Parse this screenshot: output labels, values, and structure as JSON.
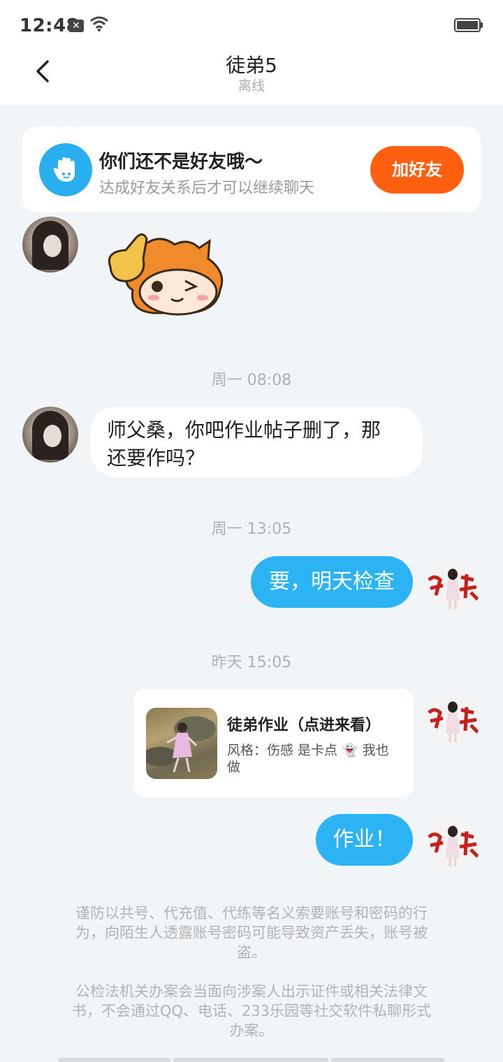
{
  "status_bar": {
    "time": "12:48",
    "notification_icon": "close-box-icon",
    "wifi_icon": "wifi-icon",
    "battery_icon": "battery-icon"
  },
  "header": {
    "title": "徒弟5",
    "subtitle": "离线",
    "back_icon": "chevron-left-icon"
  },
  "friend_banner": {
    "icon": "hand-wave-icon",
    "title": "你们还不是好友哦～",
    "subtitle": "达成好友关系后才可以继续聊天",
    "button_label": "加好友",
    "button_color": "#ff5f0e"
  },
  "messages": [
    {
      "type": "sticker",
      "sender": "other",
      "sticker_name": "wink-sticker"
    },
    {
      "type": "timestamp",
      "text": "周一 08:08"
    },
    {
      "type": "text",
      "sender": "other",
      "text_line1": "师父桑，你吧作业帖子删了，那",
      "text_line2": "还要作吗？"
    },
    {
      "type": "timestamp",
      "text": "周一 13:05"
    },
    {
      "type": "text",
      "sender": "me",
      "text": "要，明天检查"
    },
    {
      "type": "timestamp",
      "text": "昨天 15:05"
    },
    {
      "type": "card",
      "sender": "me",
      "title": "徒弟作业（点进来看）",
      "desc_line1": "风格：伤感 是卡点 👻 我也",
      "desc_line2": "做"
    },
    {
      "type": "text",
      "sender": "me",
      "text": "作业！"
    }
  ],
  "warnings": {
    "p1_line1": "谨防以共号、代充值、代练等名义索要账号和密码的行",
    "p1_line2": "为，向陌生人透露账号密码可能导致资产丢失，账号被",
    "p1_line3": "盗。",
    "p2_line1": "公检法机关办案会当面向涉案人出示证件或相关法律文",
    "p2_line2": "书，不会通过QQ、电话、233乐园等社交软件私聊形式",
    "p2_line3": "办案。"
  },
  "colors": {
    "accent_blue": "#2bb3f3",
    "background": "#f2f5f8"
  }
}
